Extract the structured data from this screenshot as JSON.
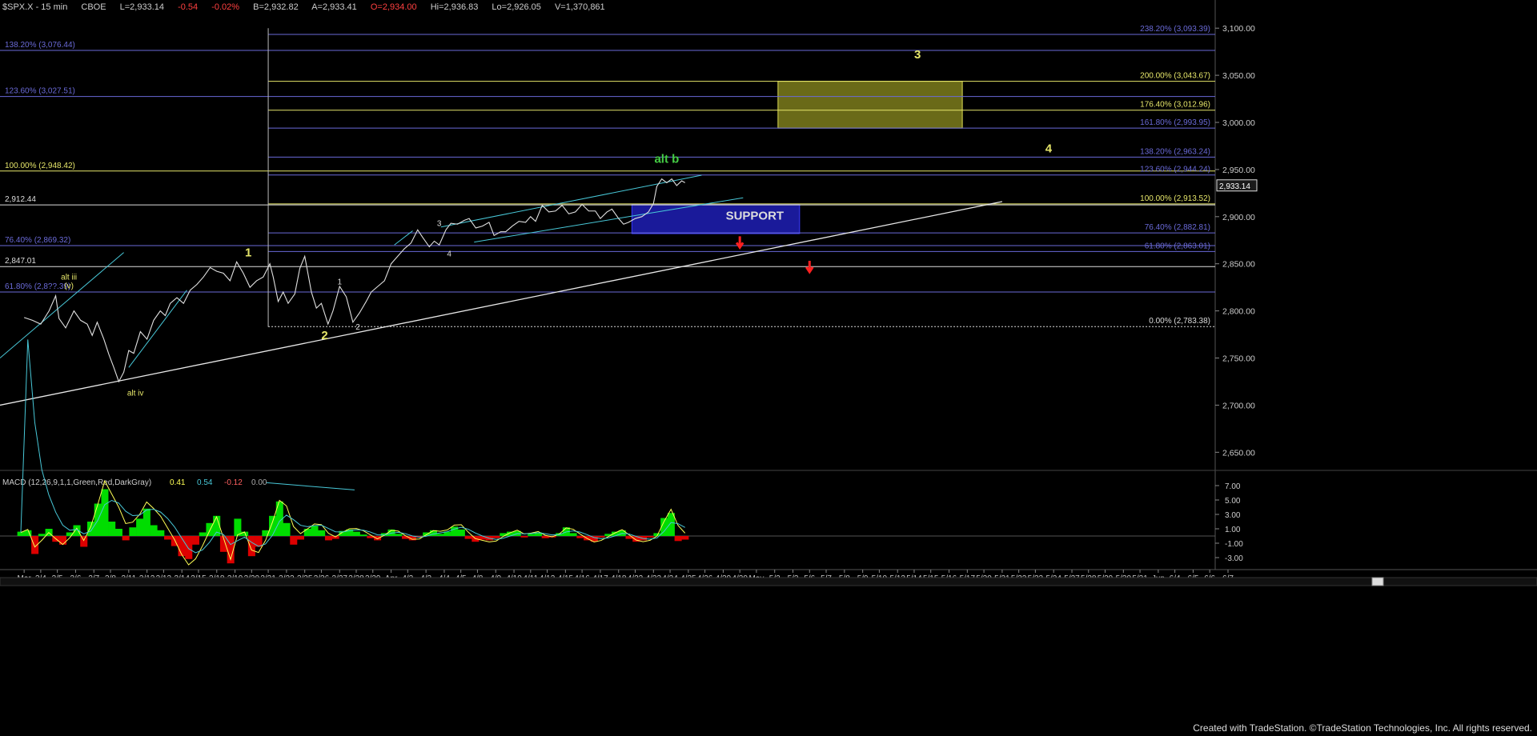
{
  "header": {
    "symbol": "$SPX.X - 15 min",
    "exchange": "CBOE",
    "last": "L=2,933.14",
    "change": "-0.54",
    "pct": "-0.02%",
    "bid": "B=2,932.82",
    "ask": "A=2,933.41",
    "open": "O=2,934.00",
    "high": "Hi=2,936.83",
    "low": "Lo=2,926.05",
    "volume": "V=1,370,861"
  },
  "footer": "Created with TradeStation. ©TradeStation Technologies, Inc. All rights reserved.",
  "colors": {
    "price": "#e0e0e0",
    "channel": "#48c8d8",
    "fib_blue": "#6a6ad8",
    "fib_yellow": "#e6e66a",
    "support": "#1a1a9a",
    "target": "#6a6a18",
    "macd_pos": "#00dd00",
    "macd_neg": "#dd0000",
    "wave_green": "#44cc44",
    "wave_yellow": "#e8e860"
  },
  "chart_data": [
    {
      "type": "line",
      "panel": "price",
      "y_axis": {
        "range": [
          2635,
          3118
        ],
        "ticks": [
          2650,
          2700,
          2750,
          2800,
          2850,
          2900,
          2950,
          3000,
          3050,
          3100
        ],
        "tick_labels": [
          "2,650.00",
          "2,700.00",
          "2,750.00",
          "2,800.00",
          "2,850.00",
          "2,900.00",
          "2,950.00",
          "3,000.00",
          "3,050.00",
          "3,100.00"
        ]
      },
      "x_axis": {
        "labels": [
          "Mar",
          "3/4",
          "3/5",
          "3/6",
          "3/7",
          "3/8",
          "3/11",
          "3/12",
          "3/13",
          "3/14",
          "3/15",
          "3/18",
          "3/19",
          "3/20",
          "3/21",
          "3/22",
          "3/25",
          "3/26",
          "3/27",
          "3/28",
          "3/29",
          "Apr",
          "4/2",
          "4/3",
          "4/4",
          "4/5",
          "4/8",
          "4/9",
          "4/10",
          "4/11",
          "4/12",
          "4/15",
          "4/16",
          "4/17",
          "4/18",
          "4/22",
          "4/23",
          "4/24",
          "4/25",
          "4/26",
          "4/29",
          "4/30",
          "May",
          "5/2",
          "5/3",
          "5/6",
          "5/7",
          "5/8",
          "5/9",
          "5/10",
          "5/13",
          "5/14",
          "5/15",
          "5/16",
          "5/17",
          "5/20",
          "5/21",
          "5/22",
          "5/23",
          "5/24",
          "5/27",
          "5/28",
          "5/29",
          "5/30",
          "5/31",
          "Jun",
          "6/4",
          "6/5",
          "6/6",
          "6/7"
        ],
        "positions": [
          0.2,
          1.2,
          2.2,
          3.3,
          4.4,
          5.4,
          6.5,
          7.6,
          8.6,
          9.7,
          10.7,
          11.8,
          12.9,
          13.9,
          14.9,
          16.0,
          17.1,
          18.1,
          19.2,
          20.2,
          21.2,
          22.3,
          23.3,
          24.4,
          25.5,
          26.5,
          27.5,
          28.6,
          29.7,
          30.7,
          31.7,
          32.8,
          33.8,
          34.9,
          36.0,
          37.0,
          38.1,
          39.1,
          40.2,
          41.2,
          42.3,
          43.3,
          44.3,
          45.4,
          46.5,
          47.5,
          48.5,
          49.6,
          50.7,
          51.7,
          52.8,
          53.8,
          54.8,
          55.9,
          57.0,
          58.0,
          59.1,
          60.1,
          61.1,
          62.2,
          63.3,
          64.3,
          65.3,
          66.4,
          67.4,
          68.5,
          69.5,
          70.6,
          71.6,
          72.7
        ]
      },
      "series": [
        {
          "values": [
            [
              0.2,
              2793
            ],
            [
              0.7,
              2790
            ],
            [
              1.2,
              2786
            ],
            [
              1.7,
              2800
            ],
            [
              2.1,
              2816
            ],
            [
              2.3,
              2792
            ],
            [
              2.7,
              2782
            ],
            [
              3.2,
              2800
            ],
            [
              3.6,
              2790
            ],
            [
              4.0,
              2786
            ],
            [
              4.3,
              2774
            ],
            [
              4.6,
              2788
            ],
            [
              5.0,
              2770
            ],
            [
              5.3,
              2754
            ],
            [
              5.6,
              2740
            ],
            [
              5.9,
              2725
            ],
            [
              6.2,
              2735
            ],
            [
              6.5,
              2758
            ],
            [
              6.8,
              2755
            ],
            [
              7.2,
              2778
            ],
            [
              7.6,
              2770
            ],
            [
              8.0,
              2790
            ],
            [
              8.4,
              2800
            ],
            [
              8.7,
              2795
            ],
            [
              9.0,
              2808
            ],
            [
              9.4,
              2814
            ],
            [
              9.8,
              2808
            ],
            [
              10.2,
              2822
            ],
            [
              10.6,
              2828
            ],
            [
              11.0,
              2836
            ],
            [
              11.4,
              2846
            ],
            [
              11.8,
              2842
            ],
            [
              12.2,
              2840
            ],
            [
              12.6,
              2832
            ],
            [
              13.0,
              2852
            ],
            [
              13.4,
              2840
            ],
            [
              13.8,
              2825
            ],
            [
              14.2,
              2832
            ],
            [
              14.6,
              2836
            ],
            [
              15.0,
              2850
            ],
            [
              15.2,
              2836
            ],
            [
              15.5,
              2810
            ],
            [
              15.8,
              2820
            ],
            [
              16.1,
              2808
            ],
            [
              16.5,
              2818
            ],
            [
              16.8,
              2845
            ],
            [
              17.1,
              2858
            ],
            [
              17.5,
              2820
            ],
            [
              17.8,
              2803
            ],
            [
              18.1,
              2808
            ],
            [
              18.5,
              2786
            ],
            [
              18.8,
              2800
            ],
            [
              19.2,
              2826
            ],
            [
              19.6,
              2815
            ],
            [
              20.0,
              2788
            ],
            [
              20.4,
              2798
            ],
            [
              20.8,
              2810
            ],
            [
              21.1,
              2820
            ],
            [
              21.5,
              2826
            ],
            [
              21.9,
              2832
            ],
            [
              22.3,
              2850
            ],
            [
              22.7,
              2858
            ],
            [
              23.1,
              2866
            ],
            [
              23.5,
              2872
            ],
            [
              23.9,
              2886
            ],
            [
              24.2,
              2878
            ],
            [
              24.6,
              2868
            ],
            [
              24.9,
              2874
            ],
            [
              25.2,
              2870
            ],
            [
              25.6,
              2886
            ],
            [
              25.9,
              2893
            ],
            [
              26.3,
              2892
            ],
            [
              26.7,
              2896
            ],
            [
              27.0,
              2898
            ],
            [
              27.4,
              2888
            ],
            [
              27.8,
              2890
            ],
            [
              28.2,
              2894
            ],
            [
              28.5,
              2880
            ],
            [
              28.9,
              2884
            ],
            [
              29.2,
              2884
            ],
            [
              29.6,
              2890
            ],
            [
              30.0,
              2895
            ],
            [
              30.4,
              2894
            ],
            [
              30.7,
              2900
            ],
            [
              31.0,
              2895
            ],
            [
              31.4,
              2912
            ],
            [
              31.8,
              2905
            ],
            [
              32.2,
              2906
            ],
            [
              32.6,
              2912
            ],
            [
              33.0,
              2903
            ],
            [
              33.4,
              2905
            ],
            [
              33.8,
              2913
            ],
            [
              34.2,
              2906
            ],
            [
              34.6,
              2906
            ],
            [
              34.9,
              2898
            ],
            [
              35.3,
              2905
            ],
            [
              35.6,
              2908
            ],
            [
              36.0,
              2898
            ],
            [
              36.3,
              2892
            ],
            [
              36.6,
              2894
            ],
            [
              37.0,
              2898
            ],
            [
              37.4,
              2900
            ],
            [
              37.8,
              2905
            ],
            [
              38.1,
              2914
            ],
            [
              38.3,
              2932
            ],
            [
              38.6,
              2940
            ],
            [
              38.9,
              2936
            ],
            [
              39.2,
              2940
            ],
            [
              39.5,
              2933
            ],
            [
              39.8,
              2938
            ],
            [
              40.0,
              2936
            ]
          ]
        }
      ],
      "horizontal_levels": [
        {
          "label": "238.20% (3,093.39)",
          "value": 3093.39,
          "side": "right",
          "color": "blue"
        },
        {
          "label": "138.20% (3,076.44)",
          "value": 3076.44,
          "side": "left",
          "color": "blue"
        },
        {
          "label": "200.00% (3,043.67)",
          "value": 3043.67,
          "side": "right",
          "color": "yellow"
        },
        {
          "label": "123.60% (3,027.51)",
          "value": 3027.51,
          "side": "left",
          "color": "blue"
        },
        {
          "label": "176.40% (3,012.96)",
          "value": 3012.96,
          "side": "right",
          "color": "yellow"
        },
        {
          "label": "161.80% (2,993.95)",
          "value": 2993.95,
          "side": "right",
          "color": "blue"
        },
        {
          "label": "138.20% (2,963.24)",
          "value": 2963.24,
          "side": "right",
          "color": "blue"
        },
        {
          "label": "100.00% (2,948.42)",
          "value": 2948.42,
          "side": "left",
          "color": "yellow"
        },
        {
          "label": "123.60% (2,944.24)",
          "value": 2944.24,
          "side": "right",
          "color": "blue"
        },
        {
          "label": "100.00% (2,913.52)",
          "value": 2913.52,
          "side": "right",
          "color": "yellow"
        },
        {
          "label": "2,912.44",
          "value": 2912.44,
          "side": "left",
          "color": "white"
        },
        {
          "label": "76.40% (2,882.81)",
          "value": 2882.81,
          "side": "right",
          "color": "blue"
        },
        {
          "label": "76.40% (2,869.32)",
          "value": 2869.32,
          "side": "left",
          "color": "blue"
        },
        {
          "label": "61.80% (2,863.01)",
          "value": 2863.01,
          "side": "right",
          "color": "blue"
        },
        {
          "label": "2,847.01",
          "value": 2847.01,
          "side": "left",
          "color": "white"
        },
        {
          "label": "61.80% (2,8??.39)",
          "value": 2820.0,
          "side": "left",
          "color": "blue"
        },
        {
          "label": "0.00% (2,783.38)",
          "value": 2783.38,
          "side": "right",
          "color": "white"
        }
      ],
      "current_price_label": "2,933.14",
      "annotations": [
        {
          "text": "3",
          "x": 54.0,
          "y": 3068,
          "color": "yellow"
        },
        {
          "text": "4",
          "x": 61.9,
          "y": 2968,
          "color": "yellow"
        },
        {
          "text": "alt b",
          "x": 38.9,
          "y": 2957,
          "color": "green"
        },
        {
          "text": "SUPPORT",
          "x": 44.2,
          "y": 2897,
          "color": "white"
        },
        {
          "text": "1",
          "x": 13.7,
          "y": 2858,
          "color": "yellow"
        },
        {
          "text": "2",
          "x": 18.3,
          "y": 2770,
          "color": "yellow"
        },
        {
          "text": "3",
          "x": 25.2,
          "y": 2890,
          "color": "white"
        },
        {
          "text": "4",
          "x": 25.8,
          "y": 2858,
          "color": "white"
        },
        {
          "text": "1",
          "x": 19.2,
          "y": 2828,
          "color": "white"
        },
        {
          "text": "2",
          "x": 20.3,
          "y": 2780,
          "color": "white"
        },
        {
          "text": "alt iii",
          "x": 2.9,
          "y": 2833,
          "color": "yellow"
        },
        {
          "text": "(v)",
          "x": 2.9,
          "y": 2824,
          "color": "yellow"
        },
        {
          "text": "alt iv",
          "x": 6.9,
          "y": 2710,
          "color": "yellow"
        }
      ]
    },
    {
      "type": "area",
      "panel": "macd",
      "legend": "MACD (12,26,9,1,1,Green,Red,DarkGray)",
      "legend_values": [
        "0.41",
        "0.54",
        "-0.12",
        "0.00"
      ],
      "y_axis": {
        "range": [
          -4,
          8
        ],
        "ticks": [
          7,
          5,
          3,
          1,
          -1,
          -3
        ],
        "tick_labels": [
          "7.00",
          "5.00",
          "3.00",
          "1.00",
          "-1.00",
          "-3.00"
        ]
      },
      "histogram": [
        0.6,
        0.8,
        -2.5,
        0.3,
        1.0,
        -0.8,
        -1.2,
        0.5,
        1.5,
        -1.5,
        2.0,
        4.5,
        6.5,
        2.0,
        1.0,
        -0.6,
        1.2,
        2.4,
        3.8,
        1.5,
        0.8,
        -0.5,
        -1.4,
        -2.8,
        -3.2,
        -1.2,
        0.5,
        1.8,
        2.8,
        -2.2,
        -3.8,
        2.4,
        0.6,
        -2.8,
        -1.5,
        0.8,
        2.8,
        4.8,
        1.8,
        -1.2,
        -0.5,
        1.0,
        1.4,
        0.8,
        -0.6,
        -0.4,
        0.7,
        0.9,
        0.6,
        0.2,
        -0.3,
        -0.6,
        0.4,
        0.9,
        0.3,
        -0.4,
        -0.6,
        -0.2,
        0.5,
        0.8,
        0.3,
        0.6,
        1.3,
        0.9,
        -0.4,
        -0.8,
        -0.5,
        -0.6,
        -0.3,
        0.4,
        0.6,
        0.7,
        -0.2,
        0.3,
        0.5,
        -0.3,
        -0.2,
        0.4,
        1.2,
        0.4,
        -0.3,
        -0.6,
        -0.8,
        -0.2,
        0.3,
        0.6,
        0.8,
        -0.4,
        -0.8,
        -0.6,
        -0.2,
        0.4,
        2.5,
        3.2,
        -0.7,
        -0.5
      ],
      "x_range": [
        0.0,
        40.0
      ]
    }
  ]
}
